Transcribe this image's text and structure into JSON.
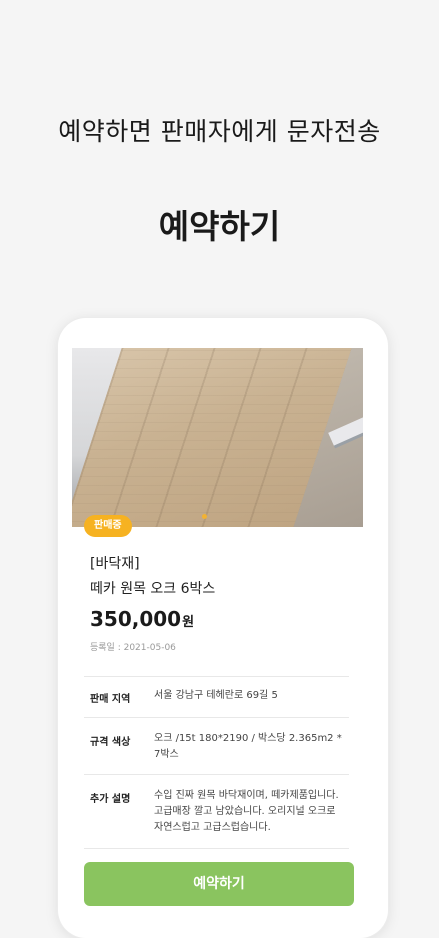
{
  "promo": {
    "headline": "예약하면 판매자에게 문자전송",
    "title": "예약하기"
  },
  "listing": {
    "status_badge": "판매중",
    "category": "[바닥재]",
    "name": "떼카 원목 오크 6박스",
    "price": "350,000",
    "price_unit": "원",
    "date_label": "등록일 : 2021-05-06",
    "details": [
      {
        "label": "판매 지역",
        "value": "서울 강남구 테헤란로 69길 5"
      },
      {
        "label": "규격 색상",
        "value": "오크 /15t 180*2190 / 박스당 2.365m2 * 7박스"
      },
      {
        "label": "추가 설명",
        "value": "수입 진짜 원목 바닥재이며, 떼카제품입니다. 고급매장 깔고 남았습니다. 오리지널 오크로 자연스럽고 고급스럽습니다."
      }
    ],
    "reserve_button": "예약하기"
  },
  "colors": {
    "accent_green": "#8ac45f",
    "badge_yellow": "#f6b221",
    "background": "#f5f5f5"
  }
}
